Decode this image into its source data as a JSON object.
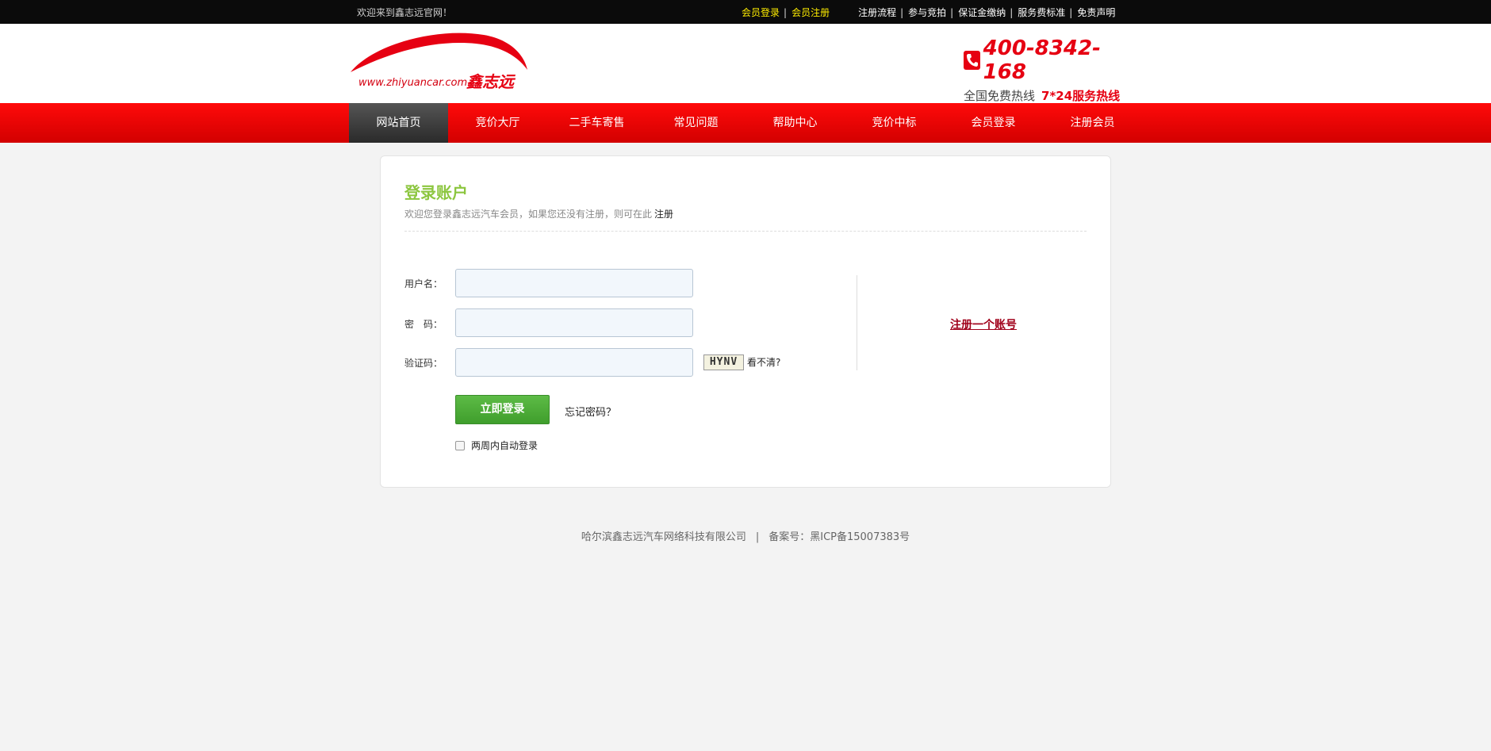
{
  "topbar": {
    "welcome": "欢迎来到鑫志远官网！",
    "member_login": "会员登录",
    "member_register": "会员注册",
    "links": [
      "注册流程",
      "参与竞拍",
      "保证金缴纳",
      "服务费标准",
      "免责声明"
    ]
  },
  "header": {
    "logo_text": "www.zhiyuancar.com",
    "logo_brand": "鑫志远",
    "hotline_number": "400-8342-168",
    "hotline_label": "全国免费热线",
    "hotline_service": "7*24服务热线"
  },
  "nav": {
    "items": [
      "网站首页",
      "竞价大厅",
      "二手车寄售",
      "常见问题",
      "帮助中心",
      "竞价中标",
      "会员登录",
      "注册会员"
    ]
  },
  "login": {
    "title": "登录账户",
    "subtitle": "欢迎您登录鑫志远汽车会员，如果您还没有注册，则可在此",
    "subtitle_link": "注册",
    "username_label": "用户名：",
    "password_label": "密　码：",
    "captcha_label": "验证码：",
    "captcha_code": "HYNV",
    "cant_see": "看不清?",
    "login_button": "立即登录",
    "forgot": "忘记密码？",
    "remember": "两周内自动登录",
    "register_account": "注册一个账号"
  },
  "footer": {
    "company": "哈尔滨鑫志远汽车网络科技有限公司",
    "separator": "|",
    "icp": "备案号：黑ICP备15007383号"
  },
  "colors": {
    "nav_red": "#e60012",
    "title_green": "#8cc63f",
    "button_green": "#4caf3a"
  }
}
